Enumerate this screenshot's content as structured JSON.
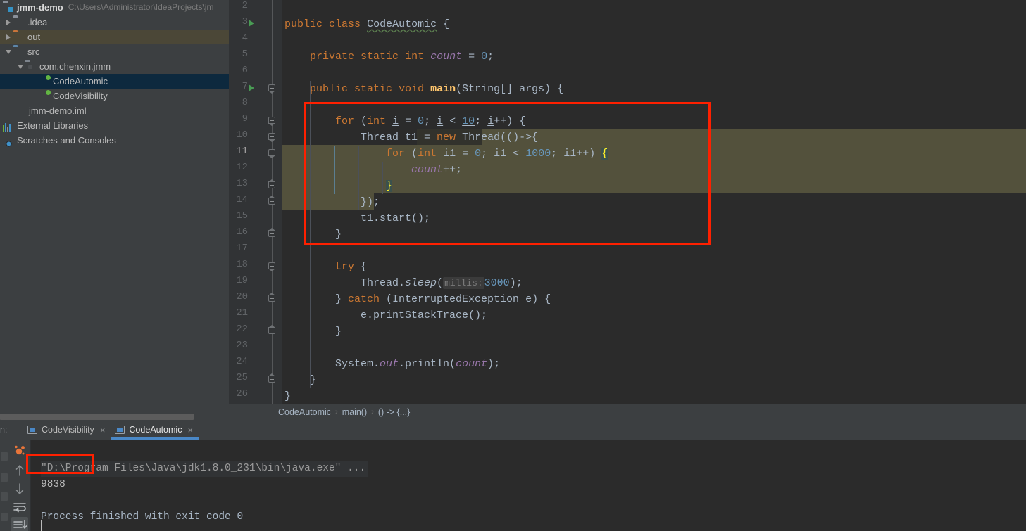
{
  "project": {
    "root": {
      "name": "jmm-demo",
      "path": "C:\\Users\\Administrator\\IdeaProjects\\jm",
      "icon": "project-icon"
    },
    "items": [
      {
        "label": ".idea",
        "icon": "folder-icon",
        "indent": 1,
        "arrow": "collapsed",
        "state": "normal"
      },
      {
        "label": "out",
        "icon": "folder-orange-icon",
        "indent": 1,
        "arrow": "collapsed",
        "state": "excluded"
      },
      {
        "label": "src",
        "icon": "folder-blue-icon",
        "indent": 1,
        "arrow": "expanded",
        "state": "normal"
      },
      {
        "label": "com.chenxin.jmm",
        "icon": "package-icon",
        "indent": 2,
        "arrow": "expanded",
        "state": "normal"
      },
      {
        "label": "CodeAutomic",
        "icon": "java-class-icon",
        "indent": 3,
        "arrow": "none",
        "state": "selected"
      },
      {
        "label": "CodeVisibility",
        "icon": "java-class-icon",
        "indent": 3,
        "arrow": "none",
        "state": "normal"
      },
      {
        "label": "jmm-demo.iml",
        "icon": "iml-file-icon",
        "indent": 1,
        "arrow": "none",
        "state": "normal"
      },
      {
        "label": "External Libraries",
        "icon": "libraries-icon",
        "indent": 0,
        "arrow": "none",
        "state": "normal"
      },
      {
        "label": "Scratches and Consoles",
        "icon": "scratches-icon",
        "indent": 0,
        "arrow": "none",
        "state": "normal"
      }
    ]
  },
  "editor": {
    "first_line_number": 2,
    "current_line": 11,
    "run_marker_lines": [
      3,
      7
    ],
    "lines": [
      {
        "n": 2,
        "text": ""
      },
      {
        "n": 3,
        "text": "public class CodeAutomic {"
      },
      {
        "n": 4,
        "text": ""
      },
      {
        "n": 5,
        "text": "    private static int count = 0;"
      },
      {
        "n": 6,
        "text": ""
      },
      {
        "n": 7,
        "text": "    public static void main(String[] args) {"
      },
      {
        "n": 8,
        "text": ""
      },
      {
        "n": 9,
        "text": "        for (int i = 0; i < 10; i++) {"
      },
      {
        "n": 10,
        "text": "            Thread t1 = new Thread(()->{"
      },
      {
        "n": 11,
        "text": "                for (int i1 = 0; i1 < 1000; i1++) {"
      },
      {
        "n": 12,
        "text": "                    count++;"
      },
      {
        "n": 13,
        "text": "                }"
      },
      {
        "n": 14,
        "text": "            });"
      },
      {
        "n": 15,
        "text": "            t1.start();"
      },
      {
        "n": 16,
        "text": "        }"
      },
      {
        "n": 17,
        "text": ""
      },
      {
        "n": 18,
        "text": "        try {"
      },
      {
        "n": 19,
        "text": "            Thread.sleep( millis: 3000);"
      },
      {
        "n": 20,
        "text": "        } catch (InterruptedException e) {"
      },
      {
        "n": 21,
        "text": "            e.printStackTrace();"
      },
      {
        "n": 22,
        "text": "        }"
      },
      {
        "n": 23,
        "text": ""
      },
      {
        "n": 24,
        "text": "        System.out.println(count);"
      },
      {
        "n": 25,
        "text": "    }"
      },
      {
        "n": 26,
        "text": "}"
      }
    ],
    "parameter_hint": "millis:",
    "highlight_color": "#53513c",
    "annotation_box_color": "#ff2000"
  },
  "breadcrumb": {
    "items": [
      "CodeAutomic",
      "main()",
      "() -> {...}"
    ],
    "separator": "›"
  },
  "run_window": {
    "label": "un:",
    "tabs": [
      {
        "title": "CodeVisibility",
        "active": false,
        "close": "×"
      },
      {
        "title": "CodeAutomic",
        "active": true,
        "close": "×"
      }
    ],
    "toolbar": [
      {
        "name": "rerun-icon"
      },
      {
        "name": "up-arrow-icon"
      },
      {
        "name": "down-arrow-icon"
      },
      {
        "name": "soft-wrap-icon"
      },
      {
        "name": "scroll-to-end-icon"
      }
    ],
    "console": {
      "command_line": "\"D:\\Program Files\\Java\\jdk1.8.0_231\\bin\\java.exe\" ...",
      "output_value": "9838",
      "exit_line": "Process finished with exit code 0"
    }
  },
  "colors": {
    "background": "#2b2b2b",
    "panel": "#3c3f41",
    "selection": "#0d293e",
    "excluded": "#4b4737",
    "accent": "#4a88c7",
    "keyword": "#cc7832",
    "number": "#6897bb",
    "field": "#9876aa",
    "method": "#ffc66d",
    "text": "#a9b7c6",
    "highlight": "#53513c",
    "annotation": "#ff2000"
  }
}
